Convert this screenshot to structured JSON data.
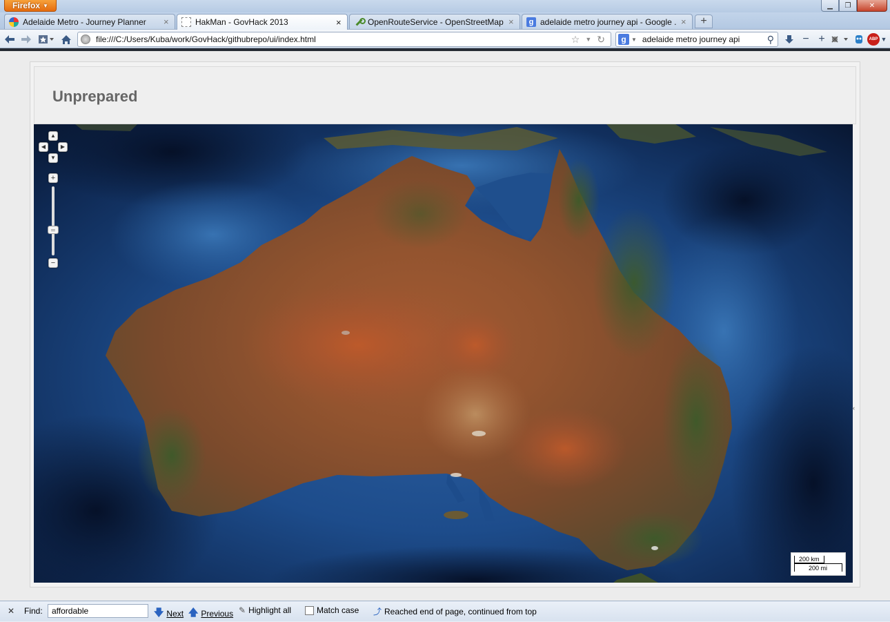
{
  "browser": {
    "app_button": "Firefox",
    "tabs": [
      {
        "label": "Adelaide Metro - Journey Planner",
        "icon": "adelaide-metro-favicon",
        "active": false
      },
      {
        "label": "HakMan - GovHack 2013",
        "icon": "blank-page-favicon",
        "active": true
      },
      {
        "label": "OpenRouteService - OpenStreetMap ...",
        "icon": "ors-favicon",
        "active": false
      },
      {
        "label": "adelaide metro journey api - Google ...",
        "icon": "google-favicon",
        "active": false
      }
    ],
    "new_tab": "+",
    "url": "file:///C:/Users/Kuba/work/GovHack/githubrepo/ui/index.html",
    "search": {
      "engine_letter": "g",
      "query": "adelaide metro journey api"
    },
    "addon_abp": "ABP"
  },
  "page": {
    "title": "Unprepared",
    "map": {
      "layer": "satellite",
      "zoom_controls": {
        "plus": "+",
        "minus": "−"
      },
      "scale": {
        "top": "200 km",
        "bottom": "200 mi"
      }
    }
  },
  "findbar": {
    "label": "Find:",
    "query": "affordable",
    "next": "Next",
    "previous": "Previous",
    "highlight_all": "Highlight all",
    "match_case": "Match case",
    "status": "Reached end of page, continued from top"
  },
  "colors": {
    "ocean": "#1b4a86",
    "land": "#8a5530",
    "firefox_orange": "#e56c0f"
  }
}
